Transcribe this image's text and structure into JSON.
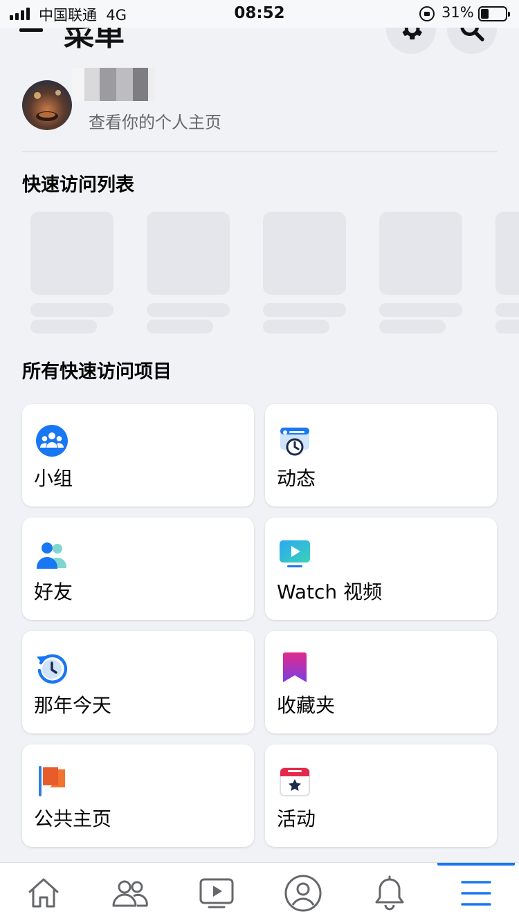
{
  "status_bar": {
    "carrier": "中国联通",
    "network": "4G",
    "time": "08:52",
    "battery": "31%"
  },
  "header": {
    "title": "菜单",
    "settings_icon": "gear-icon",
    "search_icon": "search-icon"
  },
  "profile": {
    "subtitle": "查看你的个人主页"
  },
  "quick_access": {
    "title": "快速访问列表"
  },
  "all_shortcuts": {
    "title": "所有快速访问项目",
    "items": [
      {
        "label": "小组",
        "icon": "groups-icon"
      },
      {
        "label": "动态",
        "icon": "feeds-clock-icon"
      },
      {
        "label": "好友",
        "icon": "friends-icon"
      },
      {
        "label": "Watch 视频",
        "icon": "watch-video-icon"
      },
      {
        "label": "那年今天",
        "icon": "memories-icon"
      },
      {
        "label": "收藏夹",
        "icon": "saved-bookmark-icon"
      },
      {
        "label": "公共主页",
        "icon": "pages-flag-icon"
      },
      {
        "label": "活动",
        "icon": "events-calendar-icon"
      }
    ]
  },
  "bottom_nav": {
    "items": [
      "home-icon",
      "friends-icon",
      "watch-icon",
      "profile-icon",
      "notifications-bell-icon",
      "menu-icon"
    ],
    "active": "menu-icon",
    "accent": "#1877f2"
  }
}
